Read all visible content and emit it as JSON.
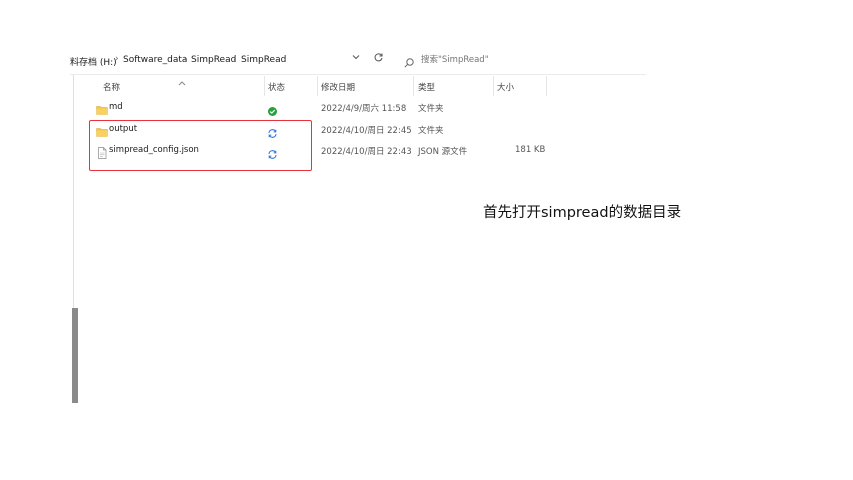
{
  "address": {
    "crumbs": [
      "料存档 (H:)",
      "Software_data",
      "SimpRead",
      "SimpRead"
    ],
    "dropdown_icon": "chevron-down-icon",
    "refresh_icon": "refresh-icon"
  },
  "search": {
    "placeholder": "搜索\"SimpRead\"",
    "icon": "search-icon"
  },
  "columns": {
    "name": "名称",
    "status": "状态",
    "date": "修改日期",
    "type": "类型",
    "size": "大小"
  },
  "files": [
    {
      "name": "md",
      "status": "synced",
      "date": "2022/4/9/周六 11:58",
      "type": "文件夹",
      "size": "",
      "icon": "folder-icon"
    },
    {
      "name": "output",
      "status": "syncing",
      "date": "2022/4/10/周日 22:45",
      "type": "文件夹",
      "size": "",
      "icon": "folder-icon"
    },
    {
      "name": "simpread_config.json",
      "status": "syncing",
      "date": "2022/4/10/周日 22:43",
      "type": "JSON 源文件",
      "size": "181 KB",
      "icon": "file-icon"
    }
  ],
  "caption": "首先打开simpread的数据目录",
  "colors": {
    "highlight": "#e8323c",
    "folder": "#f4c34a",
    "synced": "#22a33a",
    "syncing": "#2b78d4"
  }
}
